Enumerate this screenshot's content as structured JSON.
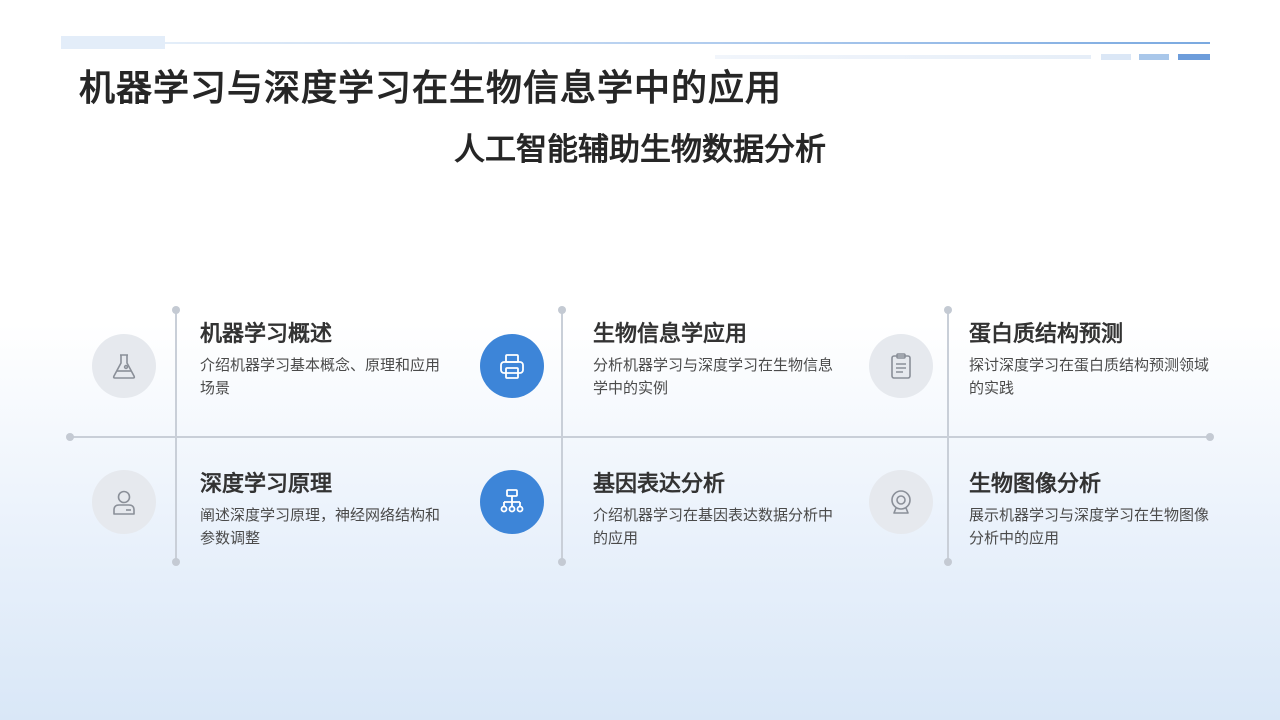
{
  "header": {
    "title": "机器学习与深度学习在生物信息学中的应用",
    "subtitle": "人工智能辅助生物数据分析"
  },
  "colors": {
    "accent": "#3d85d8",
    "icon_bg": "#e6e9ee",
    "line": "#c9cfd8"
  },
  "items": [
    {
      "title": "机器学习概述",
      "desc": "介绍机器学习基本概念、原理和应用场景",
      "icon": "flask-icon"
    },
    {
      "title": "生物信息学应用",
      "desc": "分析机器学习与深度学习在生物信息学中的实例",
      "icon": "printer-icon"
    },
    {
      "title": "蛋白质结构预测",
      "desc": "探讨深度学习在蛋白质结构预测领域的实践",
      "icon": "clipboard-icon"
    },
    {
      "title": "深度学习原理",
      "desc": "阐述深度学习原理，神经网络结构和参数调整",
      "icon": "user-icon"
    },
    {
      "title": "基因表达分析",
      "desc": "介绍机器学习在基因表达数据分析中的应用",
      "icon": "hierarchy-icon"
    },
    {
      "title": "生物图像分析",
      "desc": "展示机器学习与深度学习在生物图像分析中的应用",
      "icon": "webcam-icon"
    }
  ]
}
